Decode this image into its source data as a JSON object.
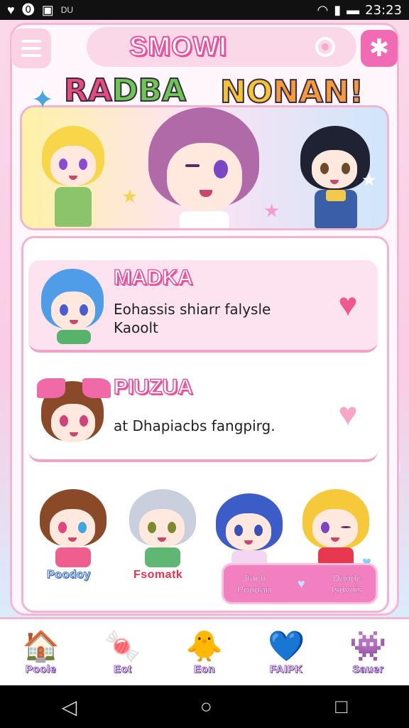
{
  "status_bar": {
    "left_icons": [
      "♥",
      "⓿",
      "▣"
    ],
    "carrier": "DU",
    "right_icons": [
      "wifi-icon",
      "signal-icon",
      "battery-icon"
    ],
    "time": "23:23"
  },
  "header": {
    "title": "SMOWI",
    "menu_icon": "hamburger-icon",
    "pill_icon": "circle-icon",
    "action_icon": "star-icon"
  },
  "banner": {
    "title_left_1": "RA",
    "title_left_2": "DBA",
    "title_right_1": "NO",
    "title_right_2": "NAN!"
  },
  "list": [
    {
      "name": "MADKA",
      "desc_line1": "Eohassis shiarr falysle",
      "desc_line2": "Kaoolt",
      "heart_icon": "heart-icon"
    },
    {
      "name": "PIUZUA",
      "desc_line1": "at Dhapiacbs fangpirg.",
      "desc_line2": "",
      "heart_icon": "heart-outline-icon"
    }
  ],
  "characters": {
    "label_blue": "Poodoy",
    "label_red": "Fsomatk"
  },
  "combo": {
    "left_line1": "Jtach",
    "left_line2": "Poudan",
    "right_line1": "Dandc",
    "right_line2": "Isdvois"
  },
  "bottom_nav": [
    {
      "label": "Poole",
      "icon": "house-icon",
      "glyph": "🏠"
    },
    {
      "label": "Eot",
      "icon": "candy-icon",
      "glyph": "🍬"
    },
    {
      "label": "Eon",
      "icon": "chick-icon",
      "glyph": "🐥"
    },
    {
      "label": "FAIPK",
      "icon": "heart-chat-icon",
      "glyph": "💙"
    },
    {
      "label": "Sauer",
      "icon": "game-icon",
      "glyph": "👾"
    }
  ],
  "colors": {
    "accent": "#f06bb4",
    "brand_pink": "#e94f9e",
    "card_bg": "#fff7fb"
  }
}
